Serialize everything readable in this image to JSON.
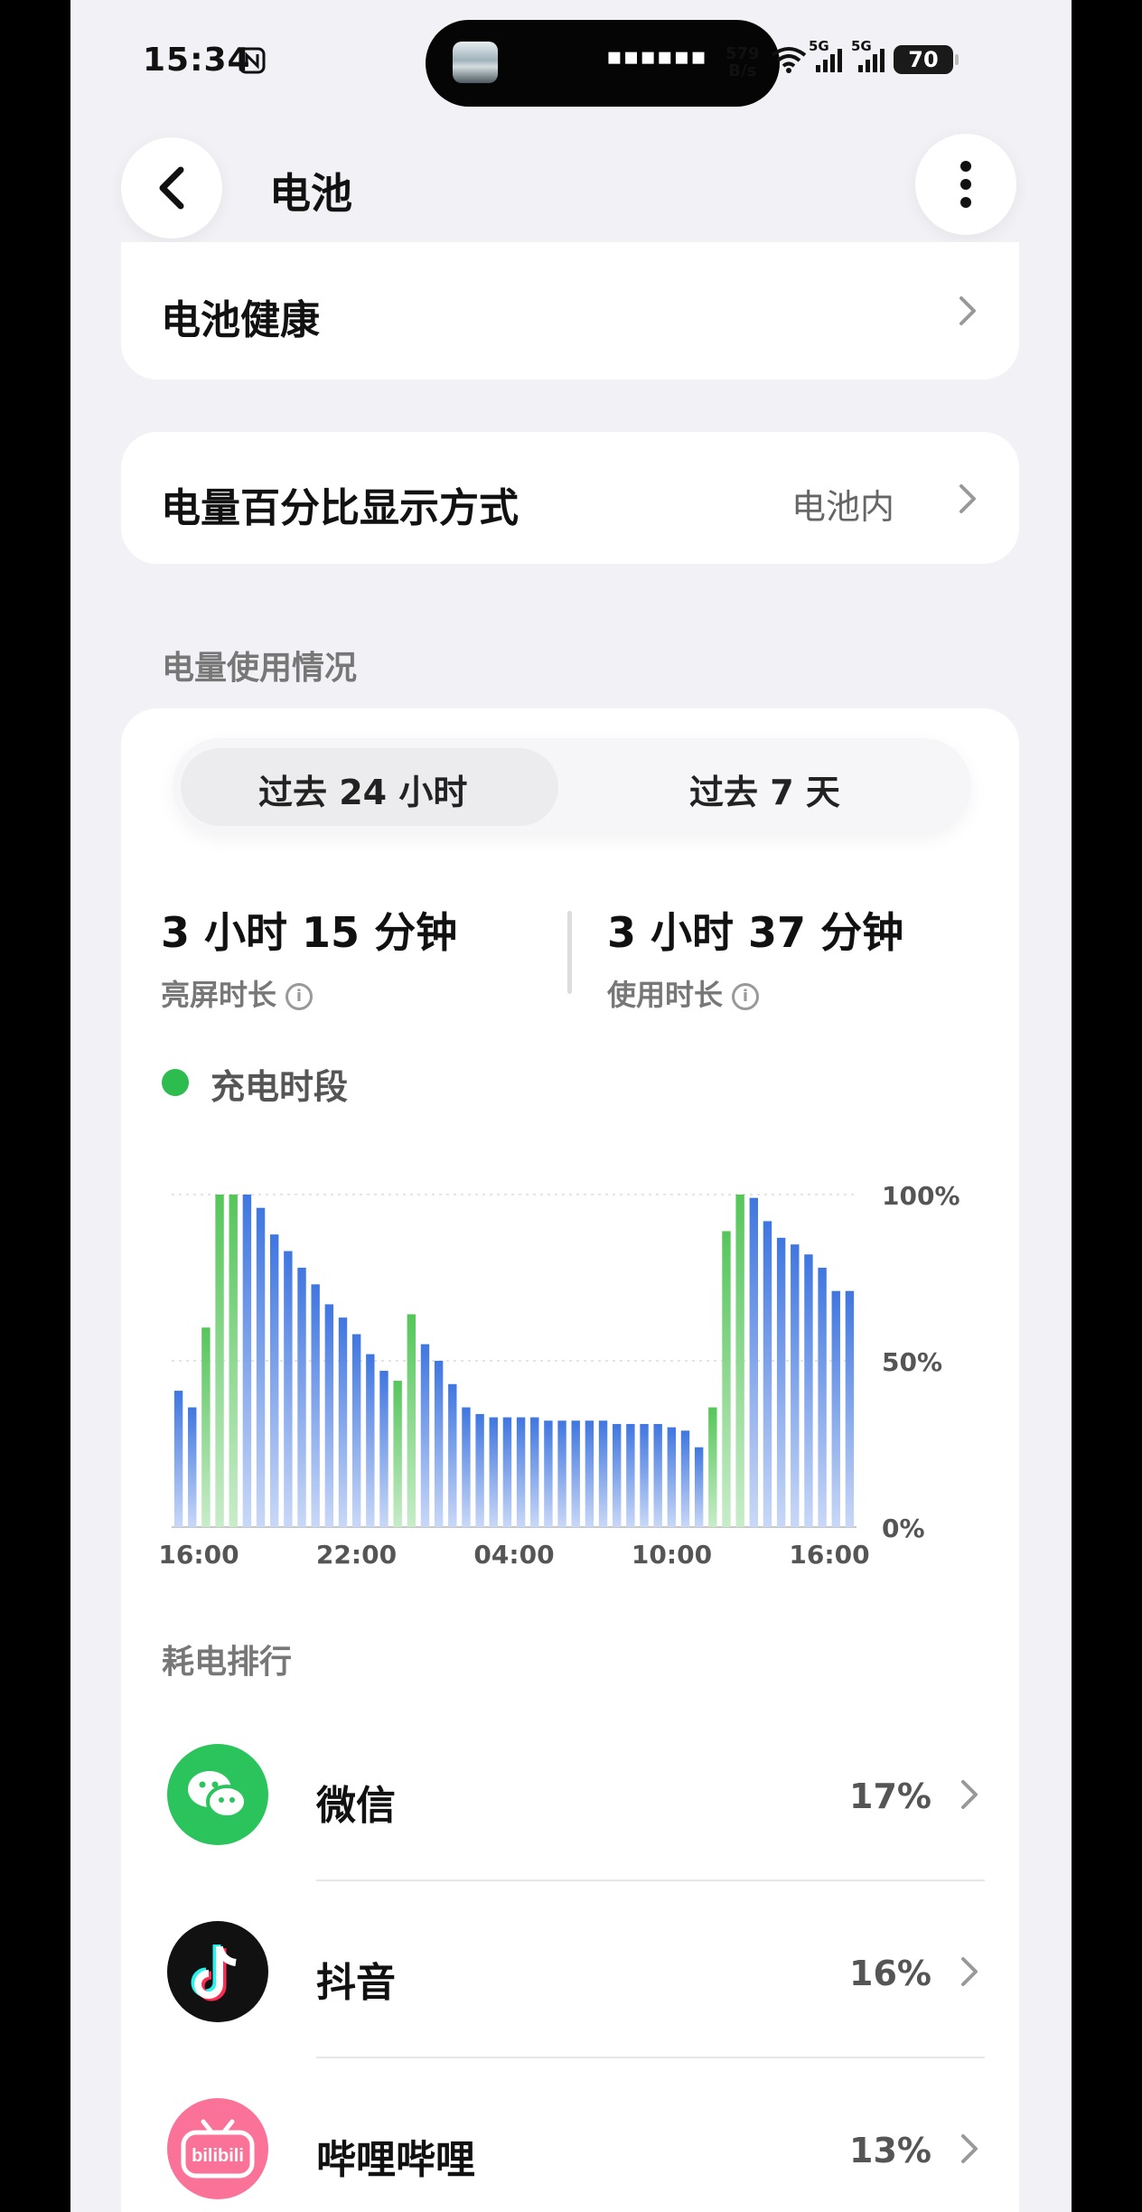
{
  "status": {
    "time": "15:34",
    "net_speed_value": "579",
    "net_speed_unit": "B/s",
    "signal_tag_1": "5G",
    "signal_tag_2": "5G",
    "battery_level": "70"
  },
  "header": {
    "title": "电池"
  },
  "rows": {
    "battery_health": "电池健康",
    "percent_display_label": "电量百分比显示方式",
    "percent_display_value": "电池内"
  },
  "usage": {
    "section_title": "电量使用情况",
    "tabs": [
      "过去 24 小时",
      "过去 7 天"
    ],
    "active_tab": 0,
    "screen_on_value": "3 小时 15 分钟",
    "screen_on_label": "亮屏时长",
    "usage_value": "3 小时 37 分钟",
    "usage_label": "使用时长",
    "legend_charging": "充电时段",
    "colors": {
      "charging": "#5fcc5f",
      "discharging": "#4a7fe0",
      "legend": "#2dbd4e"
    }
  },
  "chart_data": {
    "type": "bar",
    "title": "",
    "xlabel": "",
    "ylabel": "",
    "ylim": [
      0,
      100
    ],
    "y_ticks": [
      "0%",
      "50%",
      "100%"
    ],
    "x_ticks": [
      "16:00",
      "22:00",
      "04:00",
      "10:00",
      "16:00"
    ],
    "series": [
      {
        "values": [
          41,
          36,
          60,
          100,
          100,
          100,
          96,
          88,
          83,
          78,
          73,
          67,
          63,
          58,
          52,
          47,
          44,
          64,
          55,
          50,
          43,
          36,
          34,
          33,
          33,
          33,
          33,
          32,
          32,
          32,
          32,
          32,
          31,
          31,
          31,
          31,
          30,
          29,
          24,
          36,
          89,
          100,
          99,
          92,
          87,
          85,
          82,
          78,
          71,
          71
        ],
        "charging": [
          false,
          false,
          true,
          true,
          true,
          false,
          false,
          false,
          false,
          false,
          false,
          false,
          false,
          false,
          false,
          false,
          true,
          true,
          false,
          false,
          false,
          false,
          false,
          false,
          false,
          false,
          false,
          false,
          false,
          false,
          false,
          false,
          false,
          false,
          false,
          false,
          false,
          false,
          false,
          true,
          true,
          true,
          false,
          false,
          false,
          false,
          false,
          false,
          false,
          false
        ]
      }
    ],
    "grid": true
  },
  "ranking": {
    "section_title": "耗电排行",
    "apps": [
      {
        "name": "微信",
        "percent": "17%",
        "icon": "wechat-icon"
      },
      {
        "name": "抖音",
        "percent": "16%",
        "icon": "douyin-icon"
      },
      {
        "name": "哔哩哔哩",
        "percent": "13%",
        "icon": "bilibili-icon"
      }
    ],
    "bilibili_logo_text": "bilibili"
  }
}
